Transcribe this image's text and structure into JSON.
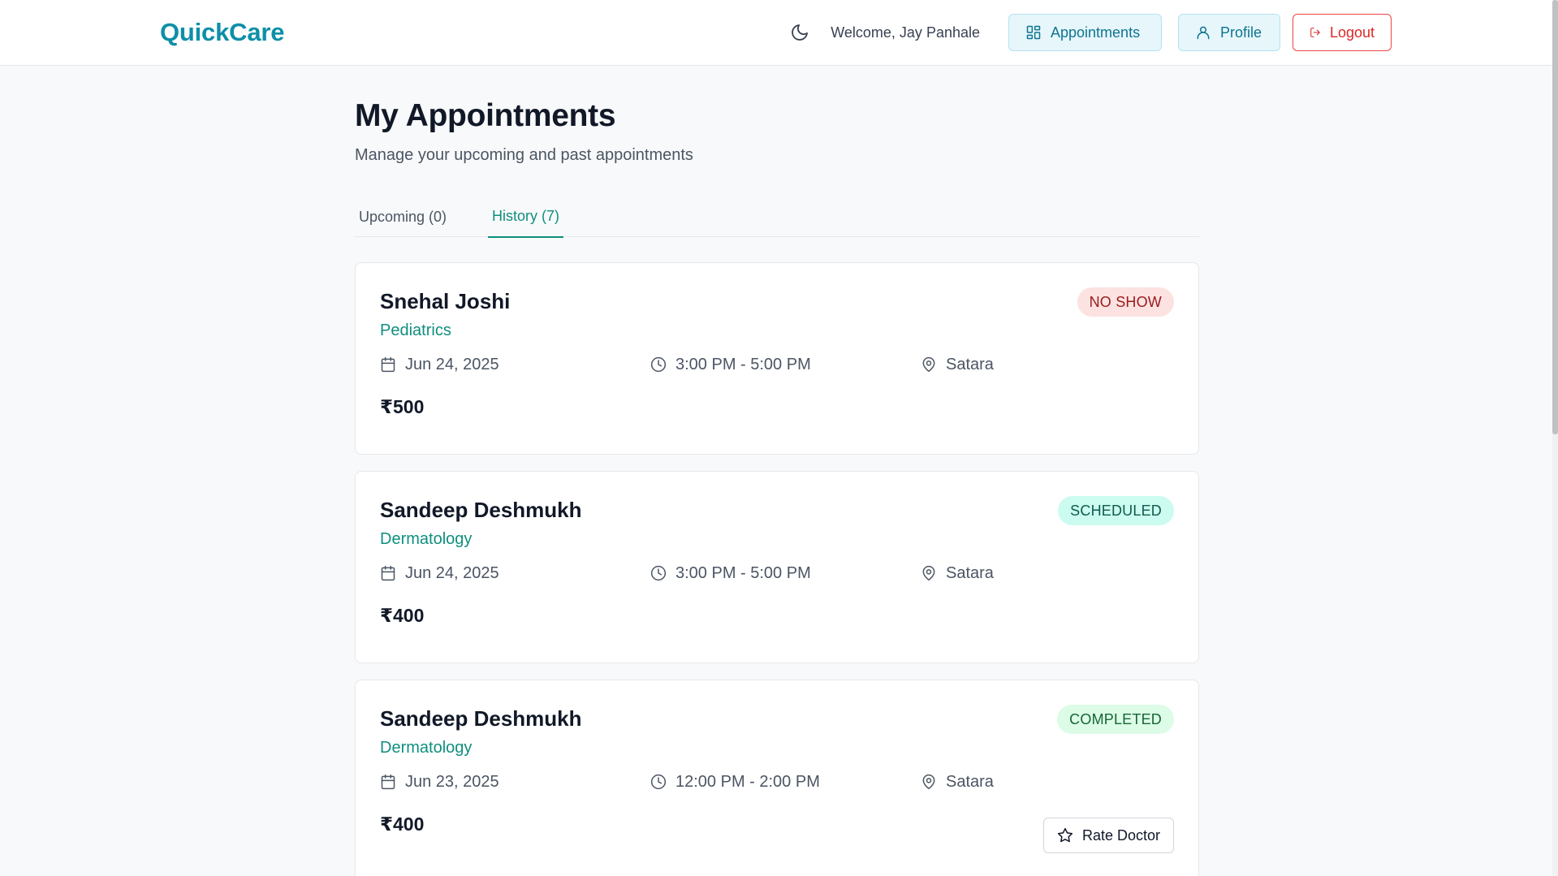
{
  "header": {
    "brand": "QuickCare",
    "welcome": "Welcome, Jay Panhale",
    "appointments_label": "Appointments",
    "profile_label": "Profile",
    "logout_label": "Logout"
  },
  "page": {
    "title": "My Appointments",
    "subtitle": "Manage your upcoming and past appointments"
  },
  "tabs": [
    {
      "label": "Upcoming (0)",
      "active": false
    },
    {
      "label": "History (7)",
      "active": true
    }
  ],
  "appointments": [
    {
      "doctor": "Snehal Joshi",
      "specialty": "Pediatrics",
      "status": "NO SHOW",
      "date": "Jun 24, 2025",
      "time": "3:00 PM - 5:00 PM",
      "location": "Satara",
      "fee": "₹500"
    },
    {
      "doctor": "Sandeep Deshmukh",
      "specialty": "Dermatology",
      "status": "SCHEDULED",
      "date": "Jun 24, 2025",
      "time": "3:00 PM - 5:00 PM",
      "location": "Satara",
      "fee": "₹400"
    },
    {
      "doctor": "Sandeep Deshmukh",
      "specialty": "Dermatology",
      "status": "COMPLETED",
      "date": "Jun 23, 2025",
      "time": "12:00 PM - 2:00 PM",
      "location": "Satara",
      "fee": "₹400",
      "action_label": "Rate Doctor"
    }
  ],
  "colors": {
    "brand": "#0e8fa8",
    "accent": "#0f8f7e",
    "danger": "#dc2626"
  },
  "icons": {
    "theme": "moon-icon",
    "appointments": "grid-icon",
    "profile": "user-icon",
    "logout": "logout-icon",
    "date": "calendar-icon",
    "time": "clock-icon",
    "location": "map-pin-icon",
    "rate": "star-icon"
  }
}
